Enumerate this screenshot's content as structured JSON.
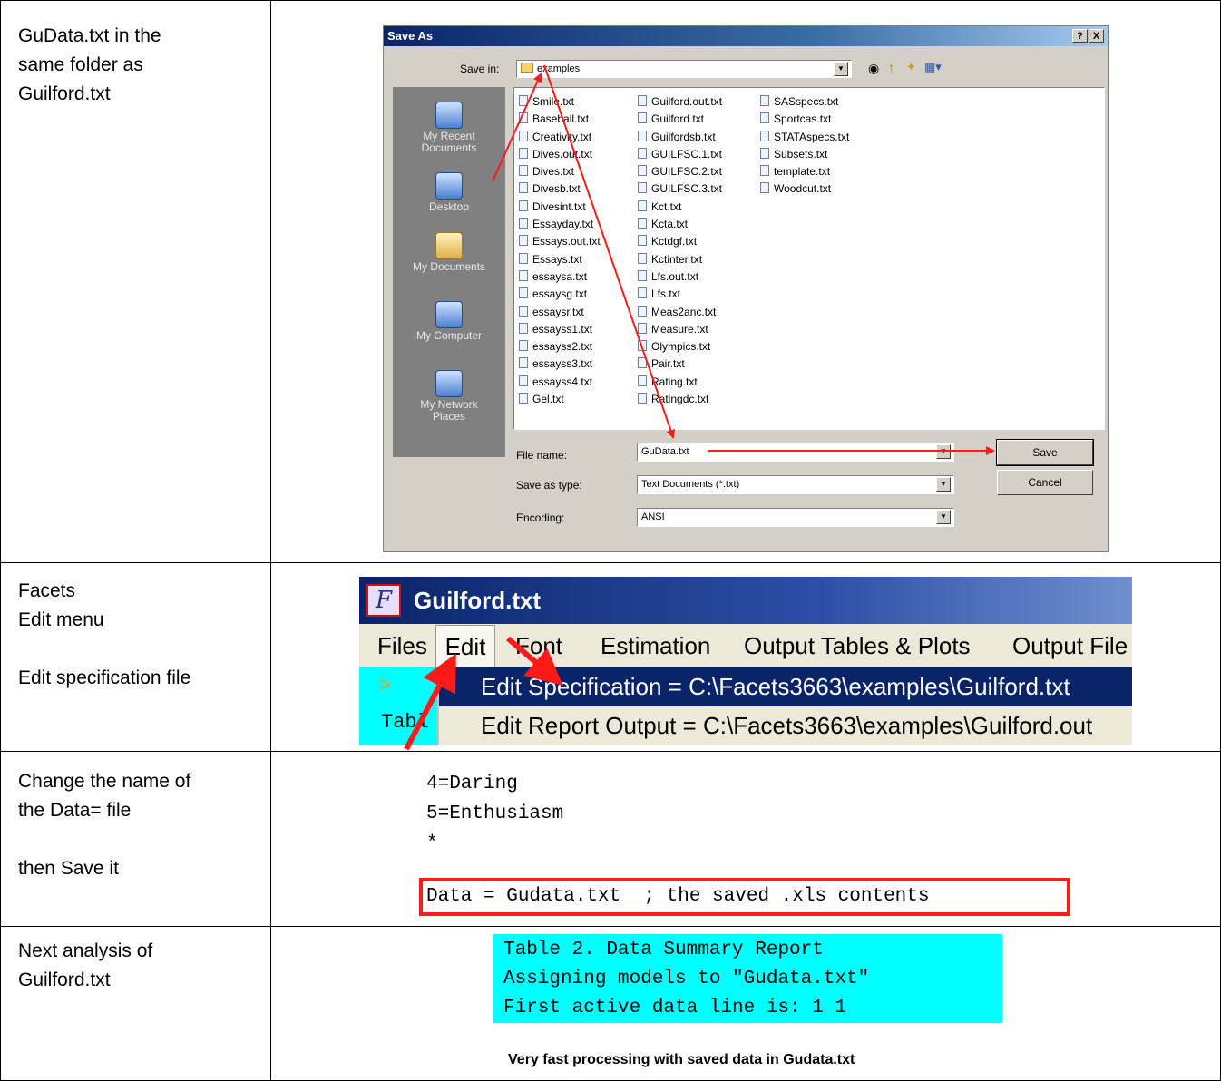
{
  "rows": [
    {
      "left_text": "GuData.txt in the\nsame folder as\nGuilford.txt"
    },
    {
      "left_text": "Facets\nEdit menu\n\nEdit specification file"
    },
    {
      "left_text": "Change the name of\nthe Data= file\n\nthen Save it"
    },
    {
      "left_text": "Next analysis of\nGuilford.txt"
    }
  ],
  "save_dialog": {
    "title": "Save As",
    "help_btn": "?",
    "close_btn": "X",
    "save_in_label": "Save in:",
    "save_in_value": "examples",
    "places": [
      "My Recent\nDocuments",
      "Desktop",
      "My Documents",
      "My Computer",
      "My Network\nPlaces"
    ],
    "files_col1": [
      "Smile.txt",
      "Baseball.txt",
      "Creativity.txt",
      "Dives.out.txt",
      "Dives.txt",
      "Divesb.txt",
      "Divesint.txt",
      "Essayday.txt",
      "Essays.out.txt",
      "Essays.txt",
      "essaysa.txt",
      "essaysg.txt",
      "essaysr.txt",
      "essayss1.txt",
      "essayss2.txt",
      "essayss3.txt",
      "essayss4.txt",
      "Gel.txt"
    ],
    "files_col2": [
      "Guilford.out.txt",
      "Guilford.txt",
      "Guilfordsb.txt",
      "GUILFSC.1.txt",
      "GUILFSC.2.txt",
      "GUILFSC.3.txt",
      "Kct.txt",
      "Kcta.txt",
      "Kctdgf.txt",
      "Kctinter.txt",
      "Lfs.out.txt",
      "Lfs.txt",
      "Meas2anc.txt",
      "Measure.txt",
      "Olympics.txt",
      "Pair.txt",
      "Rating.txt",
      "Ratingdc.txt"
    ],
    "files_col3": [
      "SASspecs.txt",
      "Sportcas.txt",
      "STATAspecs.txt",
      "Subsets.txt",
      "template.txt",
      "Woodcut.txt"
    ],
    "file_name_label": "File name:",
    "file_name_value": "GuData.txt",
    "save_as_type_label": "Save as type:",
    "save_as_type_value": "Text Documents (*.txt)",
    "encoding_label": "Encoding:",
    "encoding_value": "ANSI",
    "save_button": "Save",
    "cancel_button": "Cancel"
  },
  "facets": {
    "title": "Guilford.txt",
    "logo": "F",
    "menu": [
      "Files",
      "Edit",
      "Font",
      "Estimation",
      "Output Tables & Plots",
      "Output File"
    ],
    "drop_items": [
      "Edit Specification = C:\\Facets3663\\examples\\Guilford.txt",
      "Edit Report Output = C:\\Facets3663\\examples\\Guilford.out"
    ],
    "left_prompt": ">",
    "left_text": "Tabl"
  },
  "spec": {
    "lines": [
      "4=Daring",
      "5=Enthusiasm",
      "*"
    ],
    "data_line": "Data = Gudata.txt  ; the saved .xls contents"
  },
  "summary": {
    "lines": [
      "Table 2. Data Summary Report",
      "Assigning models to \"Gudata.txt\"",
      "First active data line is: 1 1"
    ],
    "caption": "Very fast processing with saved data in Gudata.txt"
  },
  "colors": {
    "arrow": "#ff1a1a",
    "highlight_bg": "#00ffff",
    "menu_select": "#0a246a"
  }
}
